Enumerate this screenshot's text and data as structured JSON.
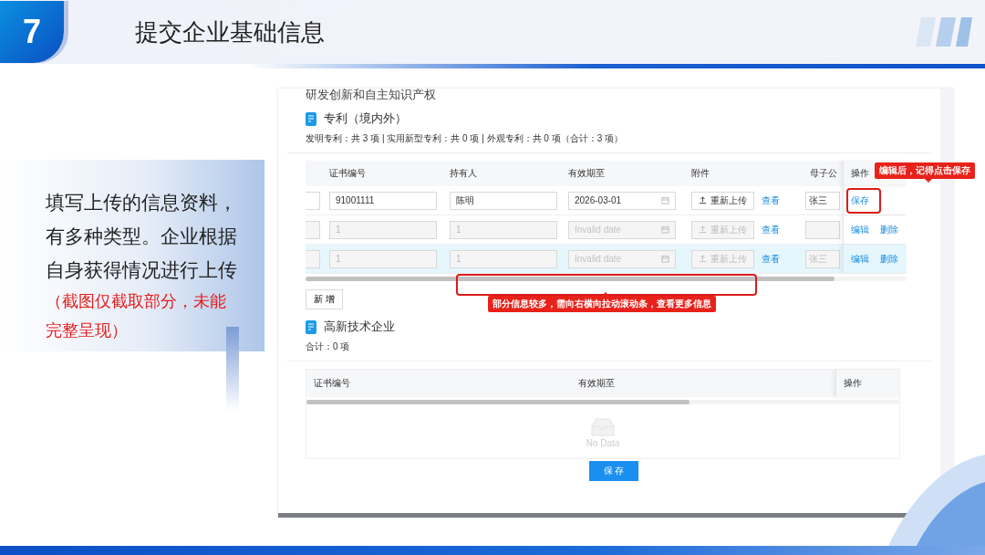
{
  "slide": {
    "number": "7",
    "title": "提交企业基础信息",
    "description": "填写上传的信息资料，有多种类型。企业根据自身获得情况进行上传",
    "note": "（截图仅截取部分，未能完整呈现）"
  },
  "screenshot": {
    "cut_heading": "研发创新和自主知识产权",
    "patents": {
      "heading": "专利（境内外）",
      "summary": "发明专利：共 3 项 | 实用新型专利：共 0 项 | 外观专利：共 0 项（合计：3 项）",
      "columns": [
        "证书编号",
        "持有人",
        "有效期至",
        "附件",
        "母子公",
        "操作"
      ],
      "rows": [
        {
          "selected": false,
          "disabled": false,
          "certificate": "91001111",
          "holder": "陈明",
          "valid_until": "2026-03-01",
          "upload_button": "重新上传",
          "view_link": "查看",
          "column_6": "张三",
          "actions": [
            "保存"
          ]
        },
        {
          "selected": false,
          "disabled": true,
          "certificate": "1",
          "holder": "1",
          "valid_until_placeholder": "Invalid date",
          "upload_button": "重新上传",
          "view_link": "查看",
          "actions": [
            "编辑",
            "删除"
          ]
        },
        {
          "selected": true,
          "disabled": true,
          "certificate": "1",
          "holder": "1",
          "valid_until_placeholder": "Invalid date",
          "upload_button": "重新上传",
          "view_link": "查看",
          "column_6": "张三",
          "actions": [
            "编辑",
            "删除"
          ]
        }
      ],
      "add_button": "新 增",
      "scroll_tip": "部分信息较多，需向右横向拉动滚动条，查看更多信息",
      "save_tip": "编辑后，记得点击保存"
    },
    "high_tech": {
      "heading": "高新技术企业",
      "summary": "合计：0 项",
      "columns": [
        "证书编号",
        "有效期至",
        "操作"
      ],
      "empty_text": "No Data",
      "save_button": "保 存"
    }
  }
}
